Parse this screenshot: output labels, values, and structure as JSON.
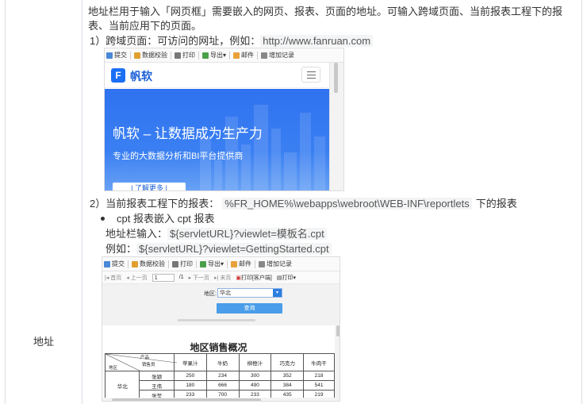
{
  "table": {
    "left_label": "地址",
    "description": "地址栏用于输入「网页框」需要嵌入的网页、报表、页面的地址。可输入跨域页面、当前报表工程下的报表、当前应用下的页面。",
    "item1": {
      "prefix": "1）跨域页面：可访问的网址，例如：",
      "code": "http://www.fanruan.com"
    },
    "item2": {
      "prefix": "2）当前报表工程下的报表：",
      "code": "%FR_HOME%\\webapps\\webroot\\WEB-INF\\reportlets",
      "suffix": "下的报表"
    },
    "bullet": "cpt 报表嵌入 cpt 报表",
    "addr_line": {
      "prefix": "地址栏输入：",
      "code": "${servletURL}?viewlet=模板名.cpt"
    },
    "example_line": {
      "prefix": "例如：",
      "code": "${servletURL}?viewlet=GettingStarted.cpt"
    }
  },
  "toolbar": {
    "submit": "提交",
    "validate": "数据校验",
    "print": "打印",
    "export": "导出",
    "mail": "邮件",
    "add_record": "增加记录"
  },
  "frame1": {
    "brand": "帆软",
    "hero_title": "帆软 – 让数据成为生产力",
    "hero_subtitle": "专业的大数据分析和BI平台提供商",
    "hero_button": "| 了解更多 |"
  },
  "frame2": {
    "pager": {
      "first": "首页",
      "prev": "上一页",
      "page": "1",
      "total": "/1",
      "next": "下一页",
      "last": "末页",
      "print_client": "打印[客户端]",
      "print": "打印"
    },
    "param_label": "地区:",
    "param_value": "华北",
    "query_button": "查询",
    "report_title": "地区销售概况",
    "header": {
      "product": "产品",
      "salesman": "销售员",
      "region": "地区"
    },
    "columns": [
      "苹果汁",
      "牛奶",
      "柳橙汁",
      "巧克力",
      "牛肉干"
    ],
    "region": "华北",
    "rows": [
      {
        "name": "张颖",
        "values": [
          "250",
          "234",
          "300",
          "352",
          "218"
        ]
      },
      {
        "name": "王伟",
        "values": [
          "180",
          "666",
          "490",
          "384",
          "541"
        ]
      },
      {
        "name": "张莹",
        "values": [
          "233",
          "700",
          "233",
          "435",
          "219"
        ]
      }
    ]
  },
  "colors": {
    "border": "#dcdfe6",
    "code_bg": "#f3f4f5",
    "hero_blue": "#2f72f0",
    "query_blue": "#4a9de8"
  }
}
